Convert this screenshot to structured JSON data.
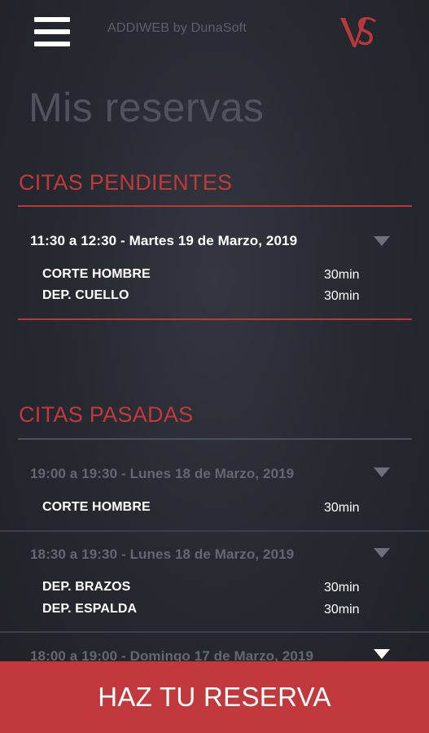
{
  "header": {
    "app_name": "ADDIWEB by DunaSoft",
    "logo_text": "VS"
  },
  "page_title": "Mis reservas",
  "pending": {
    "title": "CITAS PENDIENTES",
    "appointments": [
      {
        "datetime": "11:30 a 12:30 - Martes 19 de Marzo, 2019",
        "services": [
          {
            "name": "CORTE HOMBRE",
            "duration": "30min"
          },
          {
            "name": "DEP. CUELLO",
            "duration": "30min"
          }
        ]
      }
    ]
  },
  "past": {
    "title": "CITAS PASADAS",
    "appointments": [
      {
        "datetime": "19:00 a 19:30 - Lunes 18 de Marzo, 2019",
        "services": [
          {
            "name": "CORTE HOMBRE",
            "duration": "30min"
          }
        ]
      },
      {
        "datetime": "18:30 a 19:30 - Lunes 18 de Marzo, 2019",
        "services": [
          {
            "name": "DEP. BRAZOS",
            "duration": "30min"
          },
          {
            "name": "DEP. ESPALDA",
            "duration": "30min"
          }
        ]
      },
      {
        "datetime": "18:00 a 19:00 - Domingo 17 de Marzo, 2019",
        "services": []
      }
    ]
  },
  "cta_label": "HAZ TU RESERVA",
  "colors": {
    "accent": "#c2393d",
    "background": "#272a31",
    "muted_text": "#63676f"
  },
  "icons": {
    "menu": "hamburger-menu-icon",
    "expand": "chevron-down-icon"
  }
}
